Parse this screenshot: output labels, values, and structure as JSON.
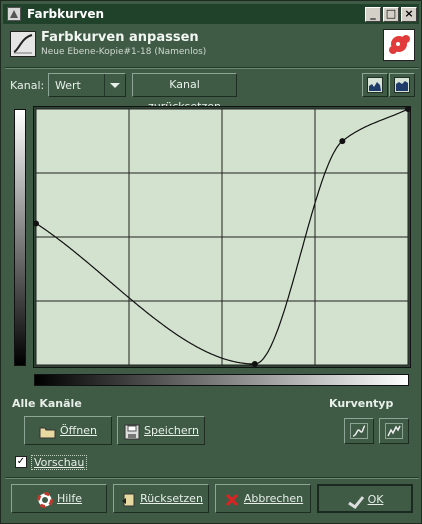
{
  "window": {
    "title": "Farbkurven"
  },
  "header": {
    "title": "Farbkurven anpassen",
    "subtitle": "Neue Ebene-Kopie#1-18 (Namenlos)"
  },
  "channel": {
    "label": "Kanal:",
    "value": "Wert",
    "reset_label": "Kanal zurücksetzen"
  },
  "curve": {
    "points": [
      [
        0,
        141
      ],
      [
        150,
        1
      ],
      [
        210,
        223
      ],
      [
        255,
        255
      ]
    ],
    "grid_divisions": 4,
    "background": "#d3e2cf"
  },
  "all_channels": {
    "label": "Alle Kanäle",
    "open_label": "Öffnen",
    "save_label": "Speichern"
  },
  "curve_type": {
    "label": "Kurventyp"
  },
  "preview": {
    "label": "Vorschau",
    "checked": true
  },
  "buttons": {
    "help": "Hilfe",
    "reset": "Rücksetzen",
    "cancel": "Abbrechen",
    "ok": "OK"
  },
  "colors": {
    "accent": "#3f5b46",
    "titlebar": "#21422a",
    "curve_bg": "#d3e2cf"
  }
}
